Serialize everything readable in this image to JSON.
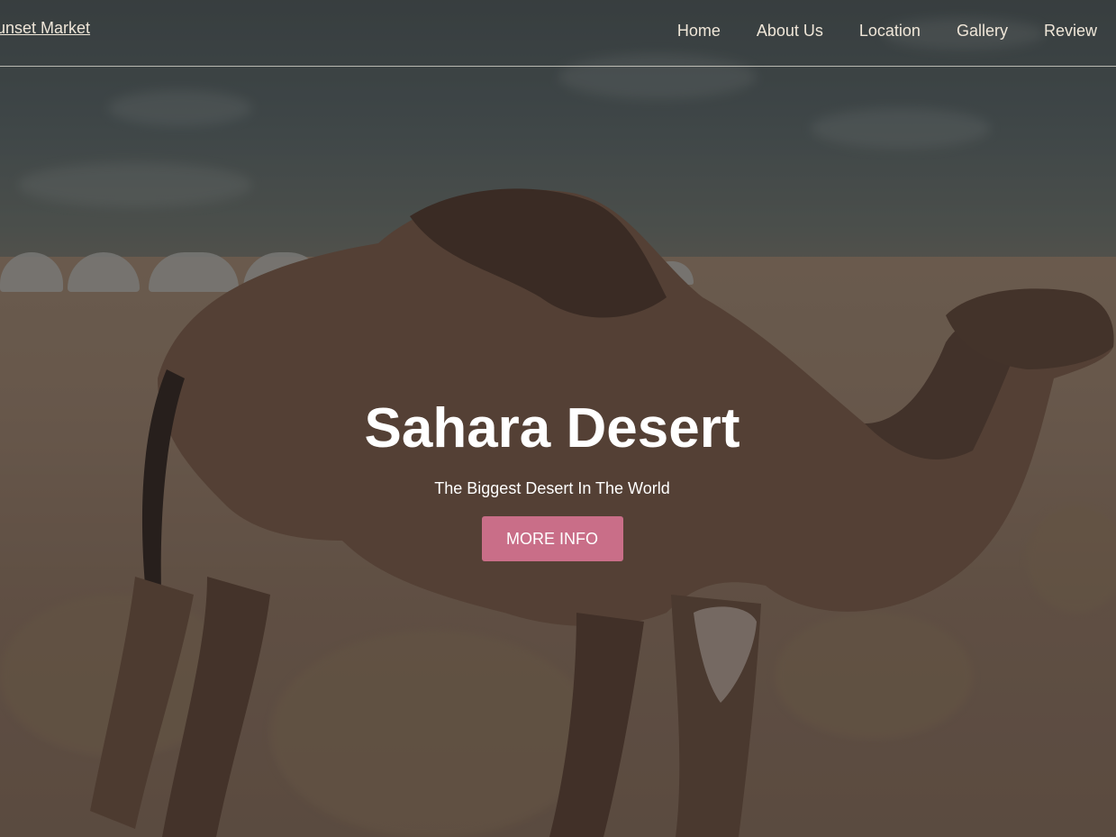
{
  "navbar": {
    "brand": "unset Market",
    "links": [
      "Home",
      "About Us",
      "Location",
      "Gallery",
      "Review"
    ]
  },
  "hero": {
    "title": "Sahara Desert",
    "subtitle": "The Biggest Desert In The World",
    "button_label": "MORE INFO"
  },
  "colors": {
    "accent_button": "#c96e88",
    "nav_text": "#efe6d8",
    "hero_text": "#ffffff"
  },
  "background_image": "camel-in-desert-photo"
}
